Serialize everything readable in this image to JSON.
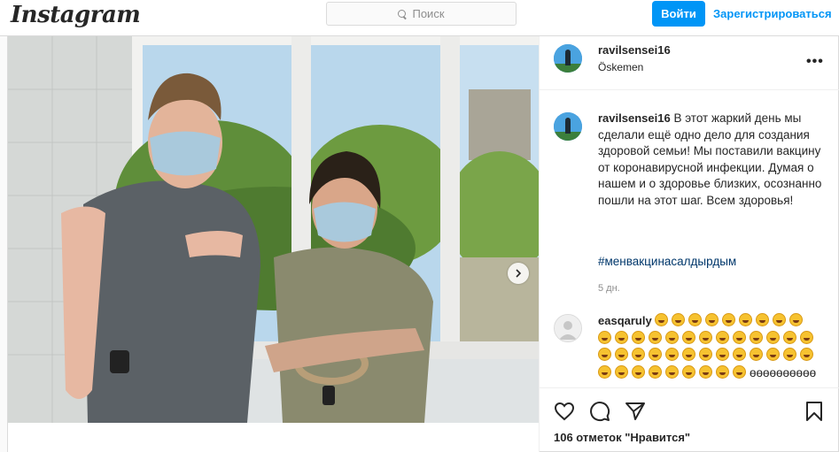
{
  "header": {
    "logo": "Instagram",
    "search_placeholder": "Поиск",
    "login_label": "Войти",
    "signup_label": "Зарегистрироваться"
  },
  "post": {
    "username": "ravilsensei16",
    "location": "Öskemen",
    "caption": "В этот жаркий день мы сделали ещё одно дело для создания здоровой семьи! Мы поставили вакцину от коронавирусной инфекции. Думая о нашем и о здоровье близких, осознанно пошли на этот шаг. Всем здоровья!",
    "hashtag": "#менвакцинасалдырдым",
    "age": "5 дн.",
    "likes": "106 отметок \"Нравится\""
  },
  "comment": {
    "username": "easqaruly",
    "emoji_name": "grinning-squinting-face",
    "emoji_count": 44,
    "tail": "өөөөөөөөөө"
  },
  "icons": {
    "more": "more-options-icon",
    "next": "chevron-right-icon",
    "like": "heart-icon",
    "comment": "comment-icon",
    "share": "send-icon",
    "save": "bookmark-icon"
  },
  "colors": {
    "accent": "#0095f6",
    "hashtag": "#00376b"
  }
}
